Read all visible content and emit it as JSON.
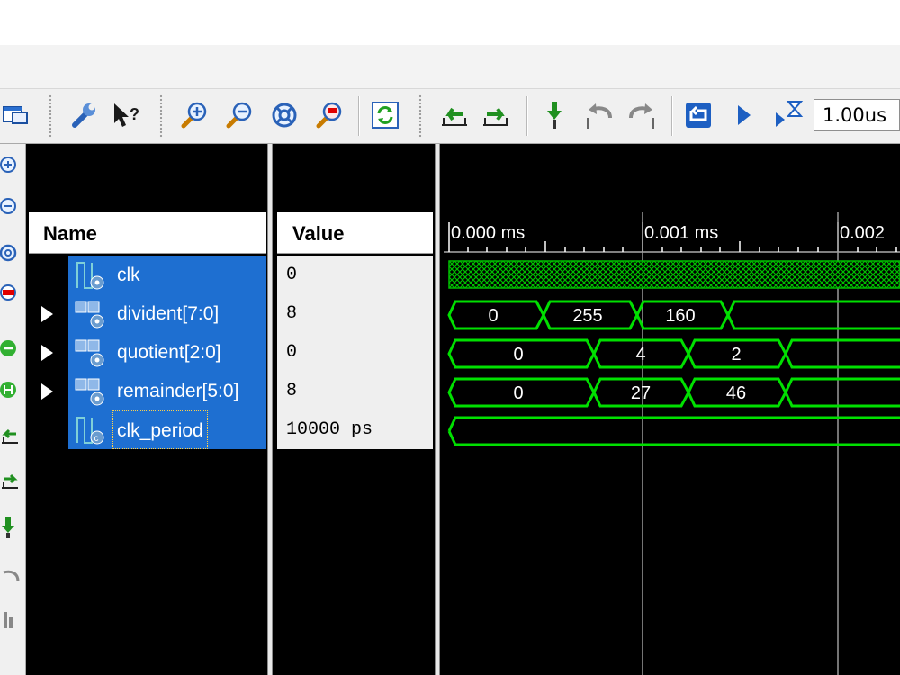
{
  "toolbar": {
    "time_value": "1.00us",
    "buttons": [
      "window-icon",
      "wrench-icon",
      "help-pointer-icon",
      "zoom-in-icon",
      "zoom-out-icon",
      "zoom-fit-icon",
      "zoom-full-icon",
      "refresh-icon",
      "prev-marker-icon",
      "next-marker-icon",
      "add-marker-icon",
      "undo-icon",
      "redo-icon",
      "restart-icon",
      "run-icon",
      "run-for-time-icon"
    ]
  },
  "left_toolbar": {
    "buttons": [
      "zoom-in-icon",
      "zoom-out-icon",
      "zoom-fit-icon",
      "remove-icon",
      "go-up-icon",
      "go-down-icon",
      "swap-left-icon",
      "swap-right-icon",
      "cursor-icon",
      "undo-icon",
      "tool-icon"
    ]
  },
  "name_panel": {
    "header": "Name"
  },
  "value_panel": {
    "header": "Value"
  },
  "signals": [
    {
      "name": "clk",
      "value": "0",
      "expandable": false,
      "kind": "logic"
    },
    {
      "name": "divident[7:0]",
      "value": "8",
      "expandable": true,
      "kind": "bus"
    },
    {
      "name": "quotient[2:0]",
      "value": "0",
      "expandable": true,
      "kind": "bus"
    },
    {
      "name": "remainder[5:0]",
      "value": "8",
      "expandable": true,
      "kind": "bus"
    },
    {
      "name": "clk_period",
      "value": "10000 ps",
      "expandable": false,
      "kind": "constant"
    }
  ],
  "ruler": {
    "labels": [
      "0.000 ms",
      "0.001 ms",
      "0.002"
    ]
  },
  "waveforms": {
    "divident": [
      "0",
      "255",
      "160"
    ],
    "quotient": [
      "0",
      "4",
      "2"
    ],
    "remainder": [
      "0",
      "27",
      "46"
    ]
  },
  "colors": {
    "wave": "#00cc00",
    "selection": "#1e6fd1",
    "background": "#000000"
  }
}
